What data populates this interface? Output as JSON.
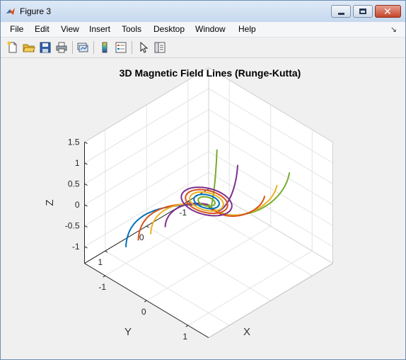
{
  "window": {
    "title": "Figure 3"
  },
  "menu": {
    "items": [
      "File",
      "Edit",
      "View",
      "Insert",
      "Tools",
      "Desktop",
      "Window",
      "Help"
    ]
  },
  "toolbar": {
    "buttons": [
      "new-figure-icon",
      "open-file-icon",
      "save-icon",
      "print-icon",
      "link-plot-icon",
      "insert-colorbar-icon",
      "insert-legend-icon",
      "edit-plot-arrow-icon",
      "property-inspector-icon"
    ]
  },
  "colors": {
    "blue": "#0072bd",
    "red": "#d95319",
    "yellow": "#edb120",
    "purple": "#7e2f8e",
    "green": "#77ac30",
    "titlebar": "#c6d8ee"
  },
  "chart_data": {
    "type": "line3d",
    "title": "3D Magnetic Field Lines (Runge-Kutta)",
    "xlabel": "X",
    "ylabel": "Y",
    "zlabel": "Z",
    "xticks": [
      "-1",
      "0",
      "1"
    ],
    "yticks": [
      "1",
      "0",
      "-1"
    ],
    "zticks": [
      "1.5",
      "1",
      "0.5",
      "0",
      "-0.5",
      "-1"
    ],
    "xlim": [
      -1.5,
      1.5
    ],
    "ylim": [
      -1.5,
      1.5
    ],
    "zlim": [
      -1.4,
      1.5
    ],
    "grid": true,
    "series": [
      {
        "color": "blue",
        "type": "outer-lower",
        "endpoint": [
          -1.0,
          1.0,
          -1.0
        ]
      },
      {
        "color": "red",
        "type": "outer-lower",
        "endpoint": [
          -0.9,
          0.8,
          -0.9
        ]
      },
      {
        "color": "yellow",
        "type": "outer-lower",
        "endpoint": [
          -0.75,
          0.65,
          -0.75
        ]
      },
      {
        "color": "purple",
        "type": "outer-lower",
        "endpoint": [
          -0.55,
          0.5,
          -0.55
        ]
      },
      {
        "color": "green",
        "type": "outer-upper",
        "endpoint": [
          1.05,
          -0.9,
          0.85
        ]
      },
      {
        "color": "purple",
        "type": "outer-upper",
        "endpoint": [
          0.4,
          -0.3,
          1.0
        ]
      },
      {
        "color": "yellow",
        "type": "outer-upper",
        "endpoint": [
          0.9,
          -0.75,
          0.55
        ]
      },
      {
        "color": "red",
        "type": "outer-upper",
        "endpoint": [
          0.8,
          -0.55,
          0.35
        ]
      },
      {
        "color": "green",
        "type": "outer-upper",
        "endpoint": [
          0.05,
          -0.15,
          1.25
        ]
      },
      {
        "color": "blue",
        "type": "loop",
        "size": 0.18
      },
      {
        "color": "red",
        "type": "loop",
        "size": 0.3
      },
      {
        "color": "yellow",
        "type": "loop",
        "size": 0.24
      },
      {
        "color": "purple",
        "type": "loop",
        "size": 0.36
      },
      {
        "color": "green",
        "type": "loop",
        "size": 0.12
      }
    ]
  }
}
